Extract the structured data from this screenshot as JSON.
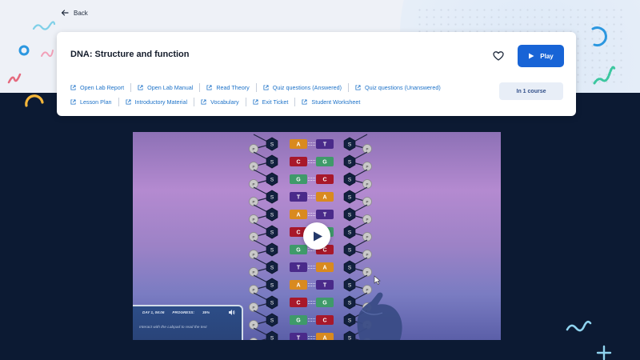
{
  "nav": {
    "back_label": "Back"
  },
  "card": {
    "title": "DNA: Structure and function",
    "play_label": "Play",
    "course_badge": "In 1 course",
    "links_row1": [
      "Open Lab Report",
      "Open Lab Manual",
      "Read Theory",
      "Quiz questions (Answered)",
      "Quiz questions (Unanswered)"
    ],
    "links_row2": [
      "Lesson Plan",
      "Introductory Material",
      "Vocabulary",
      "Exit Ticket",
      "Student Worksheet"
    ]
  },
  "video": {
    "sugar_label": "S",
    "phosphate_label": "P",
    "base_pairs": [
      [
        "A",
        "T"
      ],
      [
        "C",
        "G"
      ],
      [
        "G",
        "C"
      ],
      [
        "T",
        "A"
      ],
      [
        "A",
        "T"
      ],
      [
        "C",
        "G"
      ],
      [
        "G",
        "C"
      ],
      [
        "T",
        "A"
      ],
      [
        "A",
        "T"
      ],
      [
        "C",
        "G"
      ],
      [
        "G",
        "C"
      ],
      [
        "T",
        "A"
      ]
    ],
    "base_colors": {
      "A": "#d98a1f",
      "T": "#4a2a8a",
      "C": "#a8182a",
      "G": "#3f9a6a"
    },
    "hud": {
      "day": "DAY 1, 06:06",
      "progress_label": "PROGRESS:",
      "progress_value": "35%",
      "message": "Interact with the Labpad to read the text"
    }
  },
  "colors": {
    "accent": "#1864d6",
    "link": "#1d72c8",
    "dark_bg": "#0c1a33"
  }
}
